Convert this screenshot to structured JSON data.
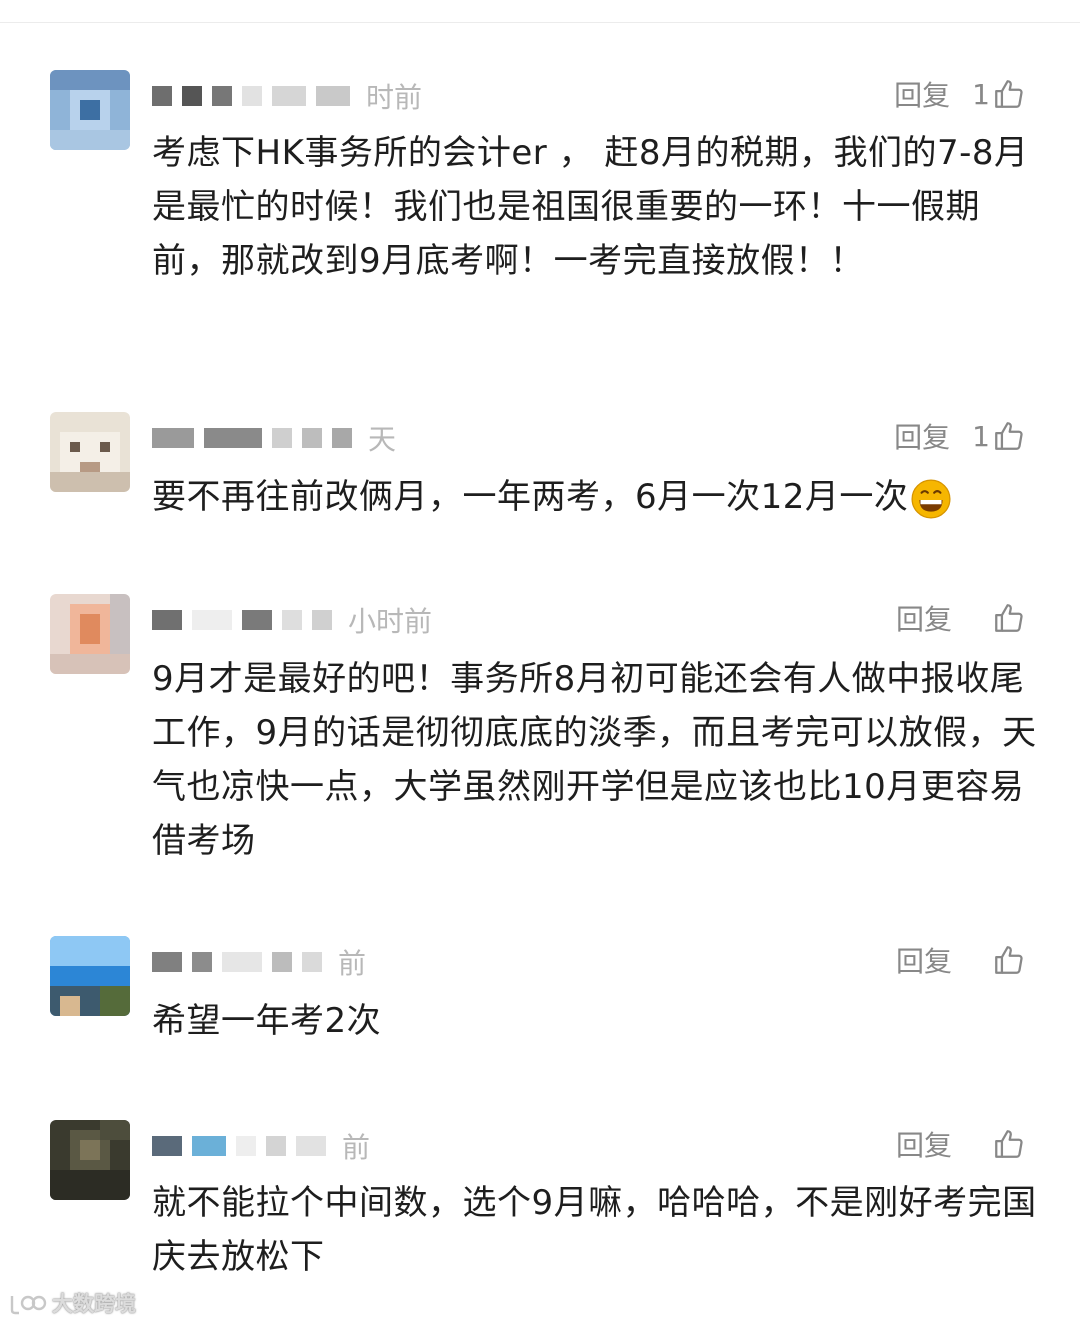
{
  "comments": [
    {
      "time_partial": "时前",
      "reply_label": "回复",
      "like_count": "1",
      "text": "考虑下HK事务所的会计er ， 赶8月的税期，我们的7-8月是最忙的时候！我们也是祖国很重要的一环！十一假期前，那就改到9月底考啊！一考完直接放假！！"
    },
    {
      "time_partial": "天",
      "reply_label": "回复",
      "like_count": "1",
      "text": "要不再往前改俩月，一年两考，6月一次12月一次",
      "emoji": "grinning-face-emoji"
    },
    {
      "time_partial": "小时前",
      "reply_label": "回复",
      "like_count": "",
      "text": "9月才是最好的吧！事务所8月初可能还会有人做中报收尾工作，9月的话是彻彻底底的淡季，而且考完可以放假，天气也凉快一点，大学虽然刚开学但是应该也比10月更容易借考场"
    },
    {
      "time_partial": "前",
      "reply_label": "回复",
      "like_count": "",
      "text": "希望一年考2次"
    },
    {
      "time_partial": "前",
      "reply_label": "回复",
      "like_count": "",
      "text": "就不能拉个中间数，选个9月嘛，哈哈哈，不是刚好考完国庆去放松下"
    }
  ],
  "watermark": {
    "text": "大数跨境"
  },
  "icons": {
    "like": "thumbs-up-icon",
    "emoji": "grinning-face-emoji",
    "watermark_logo": "brand-logo-icon"
  },
  "colors": {
    "text": "#1e1e1e",
    "meta": "#888888",
    "time": "#b8b8b8",
    "emoji": "#f6b600"
  }
}
